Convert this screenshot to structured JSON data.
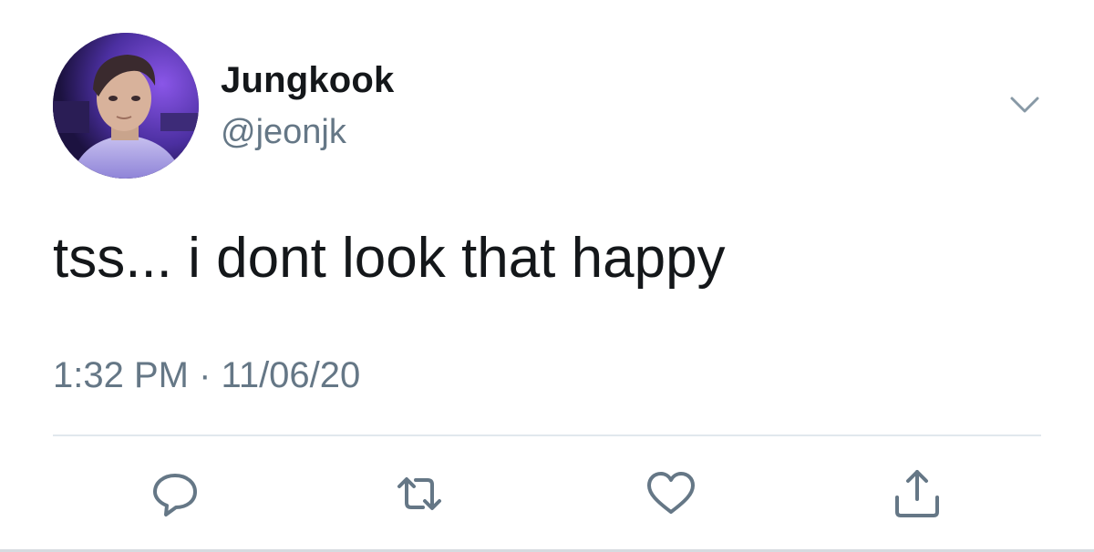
{
  "user": {
    "display_name": "Jungkook",
    "handle": "@jeonjk",
    "avatar_icon": "profile-photo"
  },
  "tweet": {
    "text": "tss... i dont look that happy",
    "time": "1:32 PM",
    "separator": "·",
    "date": "11/06/20"
  },
  "actions": [
    {
      "icon": "reply-icon"
    },
    {
      "icon": "retweet-icon"
    },
    {
      "icon": "like-icon"
    },
    {
      "icon": "share-icon"
    }
  ],
  "colors": {
    "text": "#14171a",
    "secondary": "#657786",
    "icon": "#657786",
    "divider": "#e1e8ed"
  }
}
